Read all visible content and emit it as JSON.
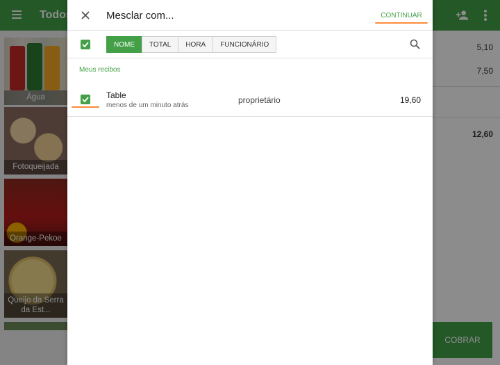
{
  "app": {
    "top_title": "Todos",
    "tiles": [
      {
        "label": "Água"
      },
      {
        "label": "Fotoqueijada"
      },
      {
        "label": "Orange-Pekoe"
      },
      {
        "label": "Queijo da Serra da Est..."
      }
    ],
    "prices": [
      "5,10",
      "7,50"
    ],
    "total": "12,60",
    "charge_label": "COBRAR"
  },
  "dialog": {
    "title": "Mesclar com...",
    "continue_label": "CONTINUAR",
    "filters": [
      {
        "label": "NOME",
        "active": true
      },
      {
        "label": "TOTAL",
        "active": false
      },
      {
        "label": "HORA",
        "active": false
      },
      {
        "label": "FUNCIONÁRIO",
        "active": false
      }
    ],
    "section_label": "Meus recibos",
    "receipts": [
      {
        "name": "Table",
        "time": "menos de um minuto atrás",
        "owner": "proprietário",
        "amount": "19,60",
        "checked": true
      }
    ]
  },
  "colors": {
    "accent": "#43a047",
    "highlight": "#ff8a3d"
  }
}
